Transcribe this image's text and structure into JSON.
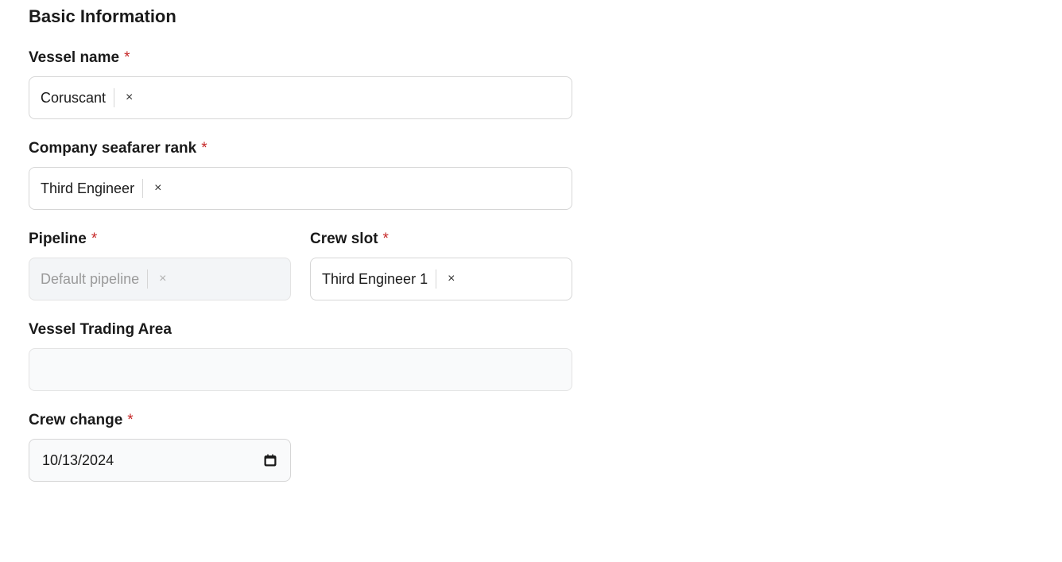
{
  "section_title": "Basic Information",
  "fields": {
    "vessel_name": {
      "label": "Vessel name",
      "required_mark": "*",
      "value": "Coruscant"
    },
    "seafarer_rank": {
      "label": "Company seafarer rank",
      "required_mark": "*",
      "value": "Third Engineer"
    },
    "pipeline": {
      "label": "Pipeline",
      "required_mark": "*",
      "value": "Default pipeline"
    },
    "crew_slot": {
      "label": "Crew slot",
      "required_mark": "*",
      "value": "Third Engineer 1"
    },
    "trading_area": {
      "label": "Vessel Trading Area",
      "value": ""
    },
    "crew_change": {
      "label": "Crew change",
      "required_mark": "*",
      "value": "10/13/2024"
    }
  }
}
